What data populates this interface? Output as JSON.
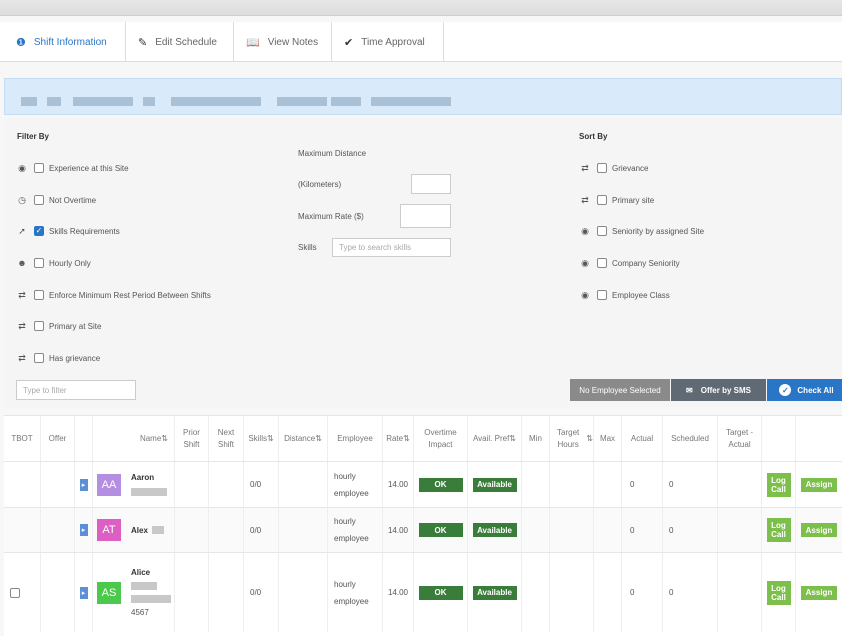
{
  "tabs": [
    {
      "label": "Shift Information",
      "icon": "info-icon"
    },
    {
      "label": "Edit Schedule",
      "icon": "pencil-icon"
    },
    {
      "label": "View Notes",
      "icon": "book-icon"
    },
    {
      "label": "Time Approval",
      "icon": "check-icon"
    }
  ],
  "filters": {
    "filter_by_label": "Filter By",
    "items": [
      {
        "label": "Experience at this Site",
        "checked": false
      },
      {
        "label": "Not Overtime",
        "checked": false
      },
      {
        "label": "Skills Requirements",
        "checked": true
      },
      {
        "label": "Hourly Only",
        "checked": false
      },
      {
        "label": "Enforce Minimum Rest Period Between Shifts",
        "checked": false
      },
      {
        "label": "Primary at Site",
        "checked": false
      },
      {
        "label": "Has grievance",
        "checked": false
      }
    ],
    "max_distance_label": "Maximum Distance",
    "km_label": "(Kilometers)",
    "max_rate_label": "Maximum Rate ($)",
    "skills_label": "Skills",
    "skills_placeholder": "Type to search skills",
    "type_to_filter": "Type to filter"
  },
  "sort": {
    "label": "Sort By",
    "items": [
      {
        "label": "Grievance"
      },
      {
        "label": "Primary site"
      },
      {
        "label": "Seniority by assigned Site"
      },
      {
        "label": "Company Seniority"
      },
      {
        "label": "Employee Class"
      }
    ]
  },
  "actions": {
    "no_employee": "No Employee Selected",
    "offer_sms": "Offer by SMS",
    "check_all": "Check All"
  },
  "table": {
    "headers": {
      "tbot": "TBOT",
      "offer": "Offer",
      "name": "Name",
      "prior": "Prior Shift",
      "next": "Next Shift",
      "skills": "Skills",
      "distance": "Distance",
      "employee": "Employee",
      "rate": "Rate",
      "overtime": "Overtime Impact",
      "avail": "Avail. Pref",
      "min": "Min",
      "target": "Target Hours",
      "max": "Max",
      "actual": "Actual",
      "scheduled": "Scheduled",
      "target_actual": "Target - Actual"
    },
    "rows": [
      {
        "initials": "AA",
        "color": "#b48ee0",
        "name": "Aaron",
        "skills": "0/0",
        "emp1": "hourly",
        "emp2": "employee",
        "rate": "14.00",
        "ot": "OK",
        "avail": "Available",
        "actual": "0",
        "sched": "0",
        "log": "Log Call",
        "assign": "Assign"
      },
      {
        "initials": "AT",
        "color": "#de5fc4",
        "name": "Alex",
        "skills": "0/0",
        "emp1": "hourly",
        "emp2": "employee",
        "rate": "14.00",
        "ot": "OK",
        "avail": "Available",
        "actual": "0",
        "sched": "0",
        "log": "Log Call",
        "assign": "Assign"
      },
      {
        "initials": "AS",
        "color": "#4cc94c",
        "name": "Alice",
        "extra": "4567",
        "skills": "0/0",
        "emp1": "hourly",
        "emp2": "employee",
        "rate": "14.00",
        "ot": "OK",
        "avail": "Available",
        "actual": "0",
        "sched": "0",
        "log": "Log Call",
        "assign": "Assign"
      }
    ]
  }
}
